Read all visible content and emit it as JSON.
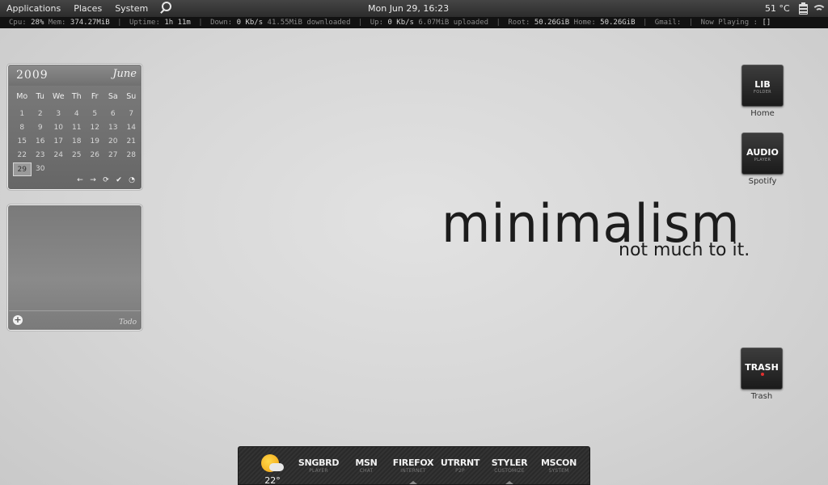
{
  "top_panel": {
    "menus": [
      "Applications",
      "Places",
      "System"
    ],
    "clock": "Mon Jun 29, 16:23",
    "temperature": "51 °C"
  },
  "conky": [
    {
      "label": "Cpu:",
      "value": "28%"
    },
    {
      "label": "Mem:",
      "value": "374.27MiB"
    },
    {
      "label": "Uptime:",
      "value": "1h 11m"
    },
    {
      "label": "Down:",
      "value": "0 Kb/s",
      "extra": "41.55MiB downloaded"
    },
    {
      "label": "Up:",
      "value": "0 Kb/s",
      "extra": "6.07MiB uploaded"
    },
    {
      "label": "Root:",
      "value": "50.26GiB"
    },
    {
      "label": "Home:",
      "value": "50.26GiB"
    },
    {
      "label": "Gmail:",
      "value": ""
    },
    {
      "label": "Now Playing :",
      "value": "[]"
    }
  ],
  "calendar": {
    "year": "2009",
    "month": "June",
    "weekdays": [
      "Mo",
      "Tu",
      "We",
      "Th",
      "Fr",
      "Sa",
      "Su"
    ],
    "weeks": [
      [
        "1",
        "2",
        "3",
        "4",
        "5",
        "6",
        "7"
      ],
      [
        "8",
        "9",
        "10",
        "11",
        "12",
        "13",
        "14"
      ],
      [
        "15",
        "16",
        "17",
        "18",
        "19",
        "20",
        "21"
      ],
      [
        "22",
        "23",
        "24",
        "25",
        "26",
        "27",
        "28"
      ],
      [
        "29",
        "30",
        "",
        "",
        "",
        "",
        ""
      ]
    ],
    "today": "29",
    "controls": [
      "←",
      "→",
      "⟳",
      "✔",
      "◔"
    ]
  },
  "todo": {
    "label": "Todo",
    "add_symbol": "+"
  },
  "desktop_icons": [
    {
      "main": "LIB",
      "sub": "FOLDER",
      "label": "Home",
      "icon": "folder-icon"
    },
    {
      "main": "AUDIO",
      "sub": "PLAYER",
      "label": "Spotify",
      "icon": "audio-player-icon"
    },
    {
      "main": "TRASH",
      "sub": "",
      "label": "Trash",
      "icon": "trash-icon"
    }
  ],
  "wallpaper": {
    "title": "minimalism",
    "subtitle": "not much to it."
  },
  "dock": {
    "weather_temp": "22°",
    "items": [
      {
        "main": "SNGBRD",
        "sub": "PLAYER"
      },
      {
        "main": "MSN",
        "sub": "CHAT"
      },
      {
        "main": "FIREFOX",
        "sub": "INTERNET"
      },
      {
        "main": "UTRRNT",
        "sub": "P2P"
      },
      {
        "main": "STYLER",
        "sub": "CUSTOMIZE"
      },
      {
        "main": "MSCON",
        "sub": "SYSTEM"
      }
    ]
  }
}
